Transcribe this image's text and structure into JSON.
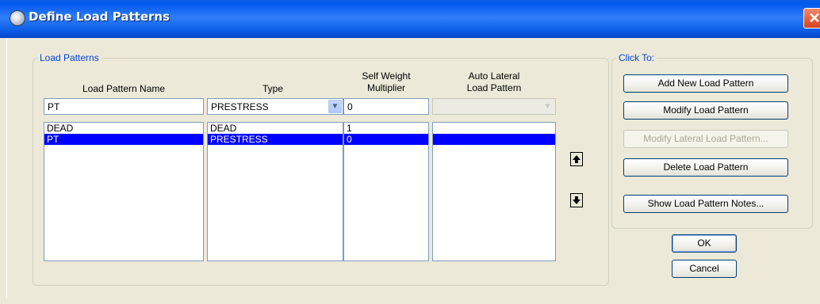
{
  "window": {
    "title": "Define Load Patterns"
  },
  "load_patterns": {
    "group_label": "Load Patterns",
    "headers": {
      "name": "Load Pattern Name",
      "type": "Type",
      "self_weight_line1": "Self Weight",
      "self_weight_line2": "Multiplier",
      "auto_lateral_line1": "Auto Lateral",
      "auto_lateral_line2": "Load Pattern"
    },
    "edit": {
      "name": "PT",
      "type": "PRESTRESS",
      "multiplier": "0",
      "auto_lateral": ""
    },
    "rows": [
      {
        "name": "DEAD",
        "type": "DEAD",
        "multiplier": "1",
        "auto_lateral": "",
        "selected": false
      },
      {
        "name": "PT",
        "type": "PRESTRESS",
        "multiplier": "0",
        "auto_lateral": "",
        "selected": true
      }
    ]
  },
  "click_to": {
    "group_label": "Click To:",
    "add_new": "Add New Load Pattern",
    "modify": "Modify Load Pattern",
    "modify_lateral": "Modify Lateral Load Pattern...",
    "delete": "Delete Load Pattern",
    "show_notes": "Show Load Pattern Notes..."
  },
  "buttons": {
    "ok": "OK",
    "cancel": "Cancel"
  },
  "icons": {
    "move_up": "arrow-up-icon",
    "move_down": "arrow-down-icon",
    "close": "close-icon",
    "app": "app-icon",
    "dropdown": "chevron-down-icon"
  },
  "colors": {
    "selection": "#0000ff",
    "group_label": "#0046d5",
    "titlebar": "#0058ee"
  }
}
